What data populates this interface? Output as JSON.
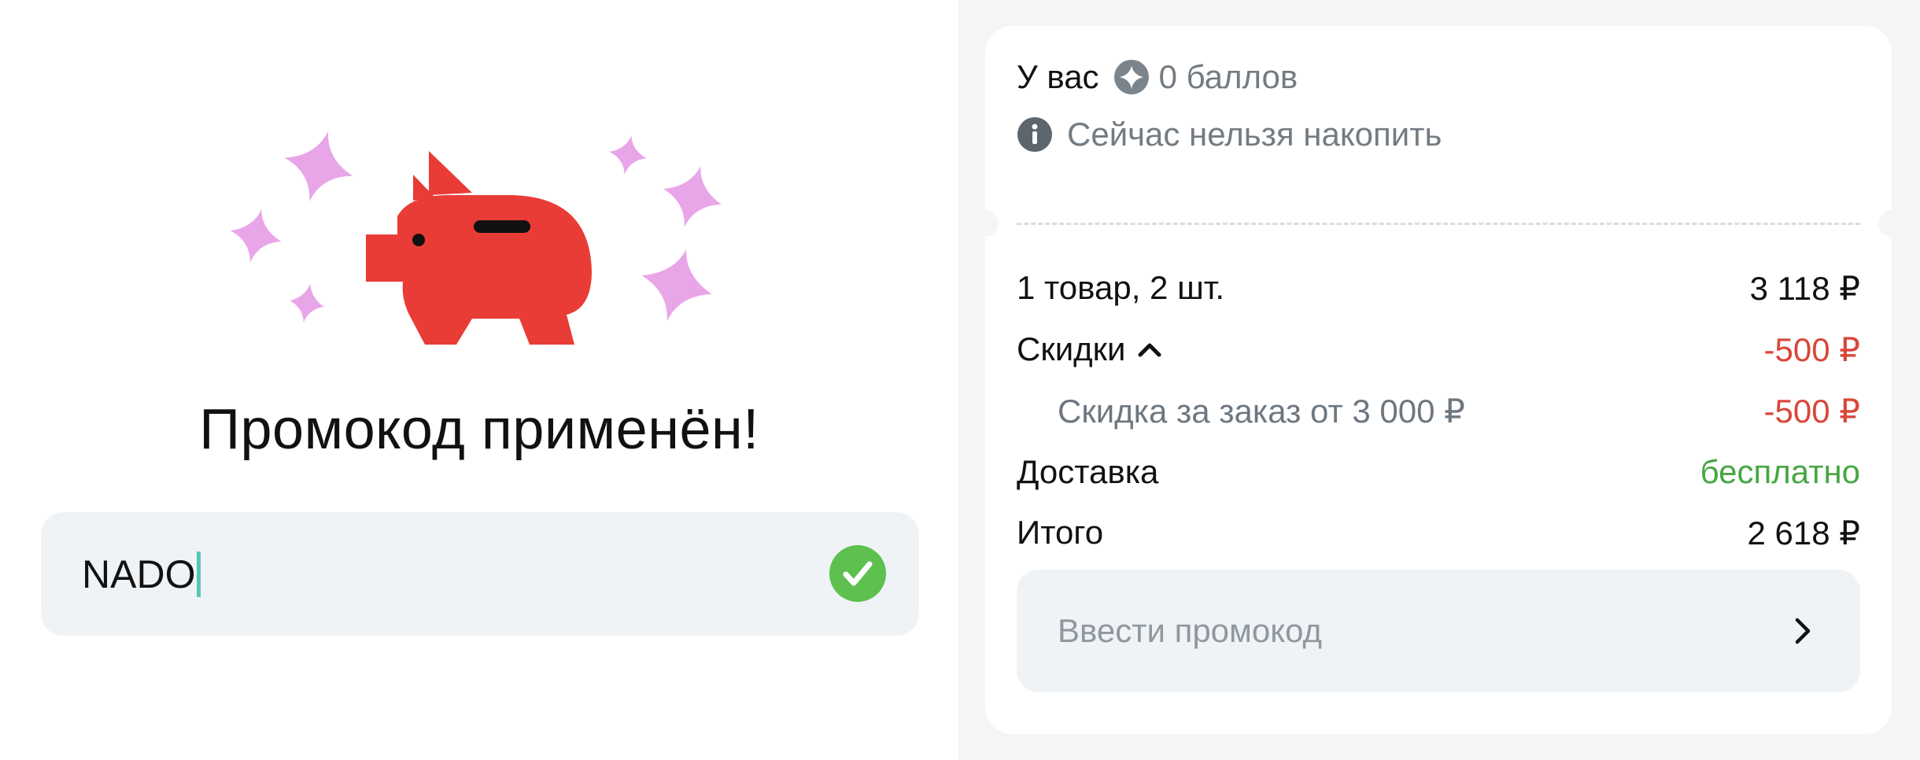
{
  "left": {
    "title": "Промокод применён!",
    "promo_input_value": "NADO",
    "icons": {
      "illustration": "piggy-bank-with-sparkles",
      "status": "check-circle-icon"
    },
    "colors": {
      "pig": "#e93c36",
      "sparkles": "#e8a6e9",
      "check": "#5dc04f",
      "caret": "#59c5b4"
    }
  },
  "summary": {
    "points_label": "У вас",
    "points_value": "0 баллов",
    "info_text": "Сейчас нельзя накопить",
    "rows": [
      {
        "label": "1 товар, 2 шт.",
        "value": "3 118 ₽"
      },
      {
        "label": "Скидки",
        "value": "-500 ₽"
      },
      {
        "label": "Скидка за заказ от 3 000 ₽",
        "value": "-500 ₽"
      },
      {
        "label": "Доставка",
        "value": "бесплатно"
      },
      {
        "label": "Итого",
        "value": "2 618 ₽"
      }
    ],
    "enter_promo_label": "Ввести промокод",
    "colors": {
      "discount": "#d8473a",
      "free": "#46a742",
      "muted": "#737b83"
    }
  }
}
